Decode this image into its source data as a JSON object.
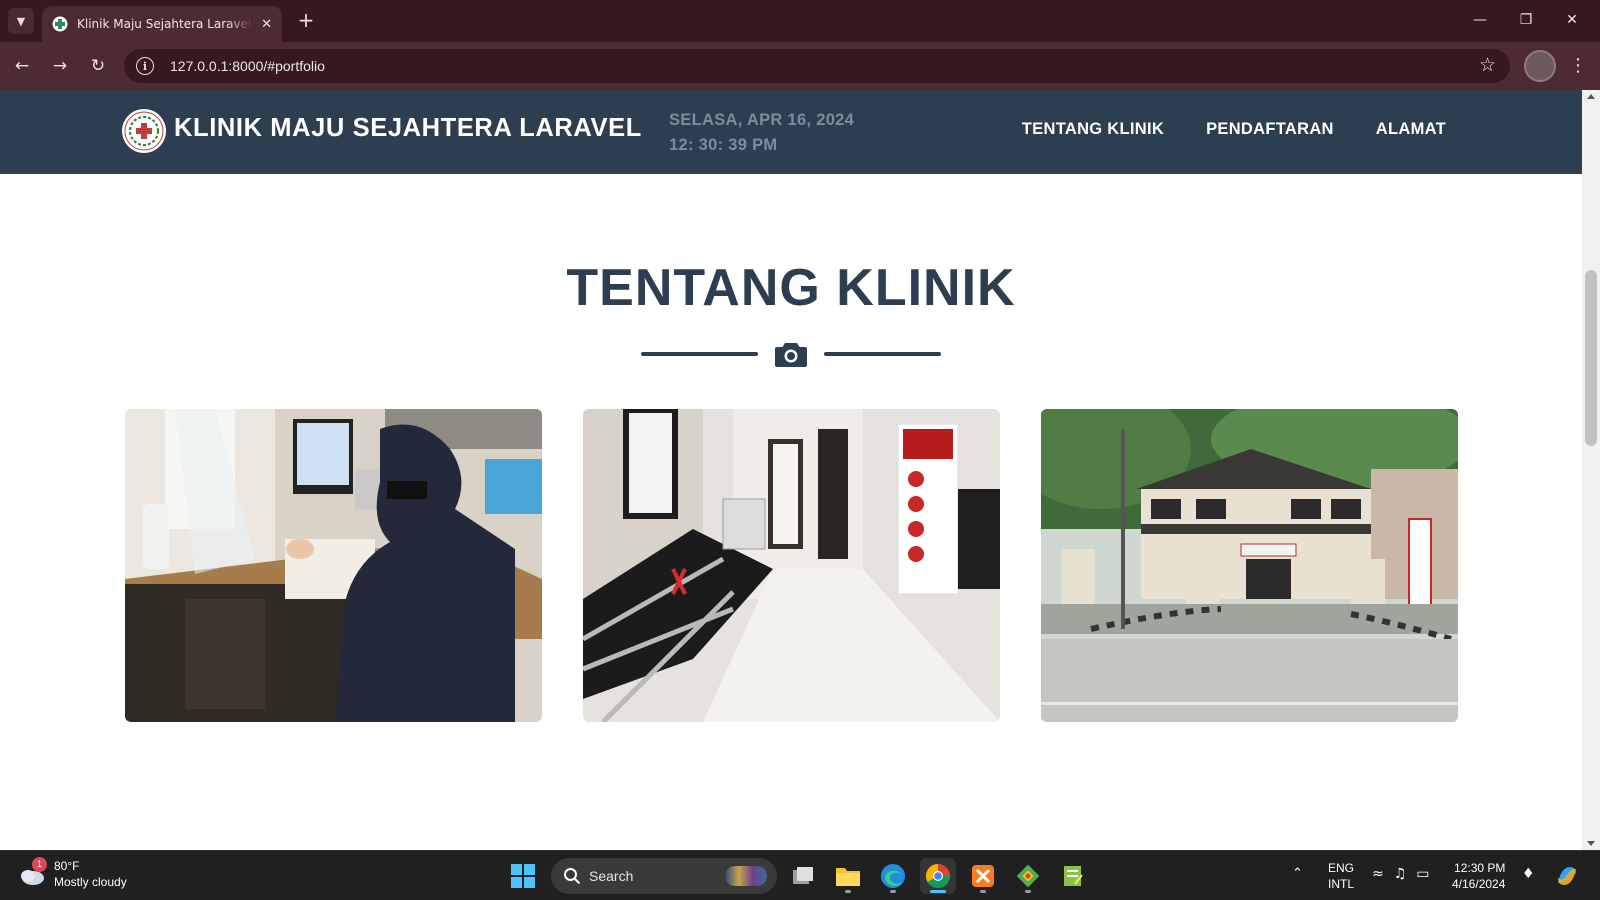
{
  "browser": {
    "tab_title": "Klinik Maju Sejahtera Laravel La",
    "url": "127.0.0.1:8000/#portfolio",
    "window_controls": [
      "minimize",
      "restore",
      "close"
    ]
  },
  "site": {
    "brand": "KLINIK MAJU SEJAHTERA LARAVEL",
    "date_line": "SELASA, APR 16, 2024",
    "time_line": "12: 30: 39 PM",
    "nav": [
      {
        "label": "TENTANG KLINIK"
      },
      {
        "label": "PENDAFTARAN"
      },
      {
        "label": "ALAMAT"
      }
    ],
    "colors": {
      "navbar": "#2c3e50",
      "heading": "#2c3e50",
      "date_text": "#7f8c9a"
    }
  },
  "section": {
    "title": "TENTANG KLINIK",
    "divider_icon": "camera-icon",
    "gallery": [
      {
        "subject": "reception-desk-photo"
      },
      {
        "subject": "waiting-room-hallway-photo"
      },
      {
        "subject": "clinic-building-exterior-photo"
      }
    ]
  },
  "taskbar": {
    "weather_temp": "80°F",
    "weather_desc": "Mostly cloudy",
    "weather_badge": "1",
    "search_label": "Search",
    "lang_top": "ENG",
    "lang_bottom": "INTL",
    "time": "12:30 PM",
    "date": "4/16/2024",
    "apps": [
      "task-view-icon",
      "file-explorer-icon",
      "edge-icon",
      "chrome-icon",
      "xampp-icon",
      "git-icon",
      "notepad-icon"
    ]
  }
}
